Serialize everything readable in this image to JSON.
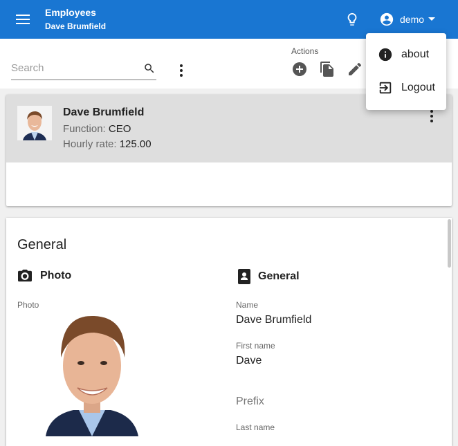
{
  "appbar": {
    "title": "Employees",
    "subtitle": "Dave Brumfield",
    "user": "demo",
    "menu_icon": "hamburger-menu-icon",
    "bulb_icon": "lightbulb-icon",
    "color": "#1976d2"
  },
  "search": {
    "placeholder": "Search"
  },
  "actions": {
    "label": "Actions"
  },
  "employee": {
    "name": "Dave Brumfield",
    "function_label": "Function:",
    "function_value": "CEO",
    "rate_label": "Hourly rate:",
    "rate_value": "125.00"
  },
  "detail": {
    "section_title": "General",
    "photo_group": "Photo",
    "photo_label": "Photo",
    "general_group": "General",
    "fields": [
      {
        "label": "Name",
        "value": "Dave Brumfield"
      },
      {
        "label": "First name",
        "value": "Dave"
      },
      {
        "label": "Prefix",
        "value": ""
      },
      {
        "label": "Last name",
        "value": ""
      }
    ]
  },
  "user_menu": {
    "items": [
      {
        "label": "about",
        "icon": "info-icon"
      },
      {
        "label": "Logout",
        "icon": "logout-icon"
      }
    ]
  }
}
